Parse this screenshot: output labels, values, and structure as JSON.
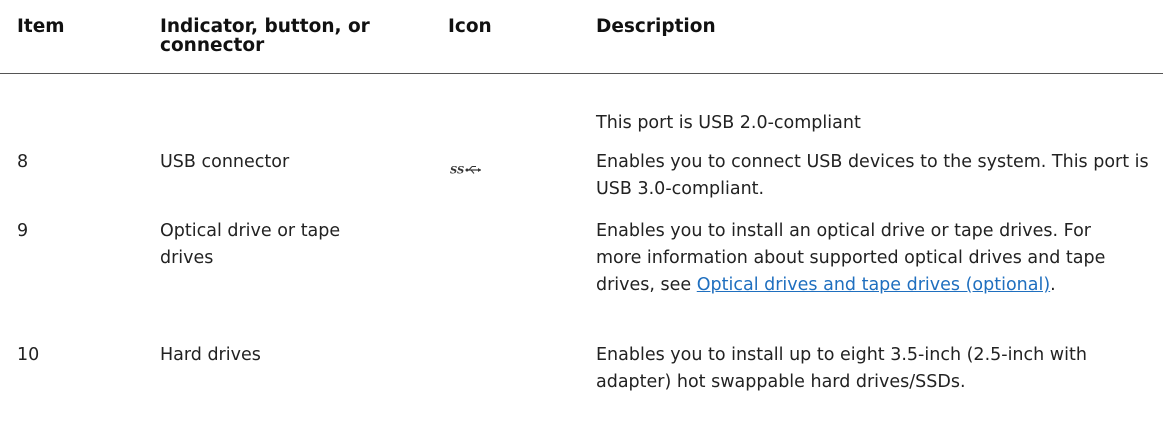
{
  "columns": {
    "item": "Item",
    "indicator": "Indicator, button, or connector",
    "icon": "Icon",
    "description": "Description"
  },
  "continued_row": {
    "description": "This port is USB 2.0-compliant"
  },
  "rows": [
    {
      "item": "8",
      "indicator": "USB connector",
      "icon": "usb-3-superspeed-icon",
      "description": "Enables you to connect USB devices to the system. This port is USB 3.0-compliant."
    },
    {
      "item": "9",
      "indicator": "Optical drive or tape drives",
      "description_before_link": "Enables you to install an optical drive or tape drives. For more information about supported optical drives and tape drives, see ",
      "link_text": "Optical drives and tape drives (optional)",
      "description_after_link": "."
    },
    {
      "item": "10",
      "indicator": "Hard drives",
      "description": "Enables you to install up to eight 3.5-inch (2.5-inch with adapter) hot swappable hard drives/SSDs."
    }
  ],
  "colors": {
    "link": "#1f6fbf",
    "rule": "#555555"
  }
}
